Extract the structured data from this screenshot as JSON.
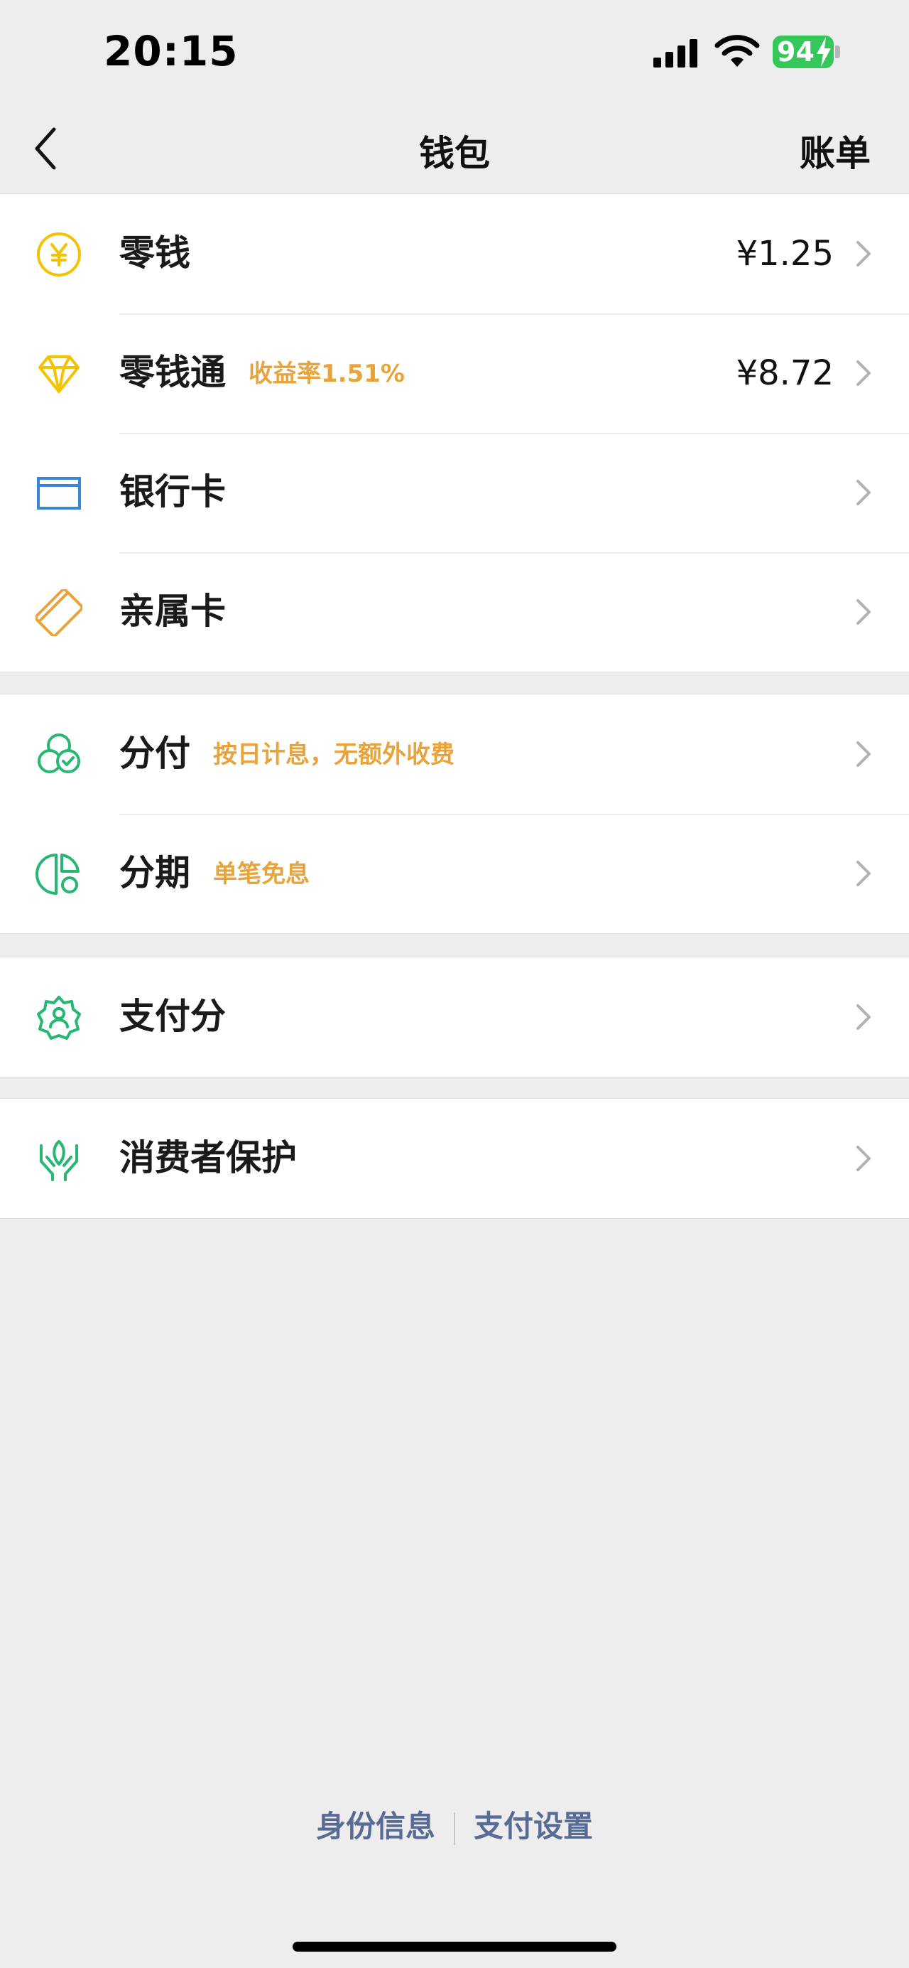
{
  "status_bar": {
    "time": "20:15",
    "battery": "94"
  },
  "nav": {
    "title": "钱包",
    "right_action": "账单"
  },
  "groups": [
    {
      "rows": [
        {
          "label": "零钱",
          "value": "¥1.25",
          "icon": "yen-coin-icon"
        },
        {
          "label": "零钱通",
          "tag": "收益率1.51%",
          "value": "¥8.72",
          "icon": "diamond-icon"
        },
        {
          "label": "银行卡",
          "icon": "bank-card-icon"
        },
        {
          "label": "亲属卡",
          "icon": "family-card-icon"
        }
      ]
    },
    {
      "rows": [
        {
          "label": "分付",
          "tag": "按日计息，无额外收费",
          "icon": "fenfu-icon"
        },
        {
          "label": "分期",
          "tag": "单笔免息",
          "icon": "installment-icon"
        }
      ]
    },
    {
      "rows": [
        {
          "label": "支付分",
          "icon": "pay-score-icon"
        }
      ]
    },
    {
      "rows": [
        {
          "label": "消费者保护",
          "icon": "consumer-protection-icon"
        }
      ]
    }
  ],
  "footer": {
    "identity_link": "身份信息",
    "settings_link": "支付设置"
  },
  "colors": {
    "background": "#ededed",
    "tag": "#e8a33b",
    "link": "#576b95",
    "yellow_icon": "#f3c200",
    "blue_icon": "#3a86d4",
    "orange_icon": "#e8a33b",
    "green_icon": "#26b772"
  }
}
